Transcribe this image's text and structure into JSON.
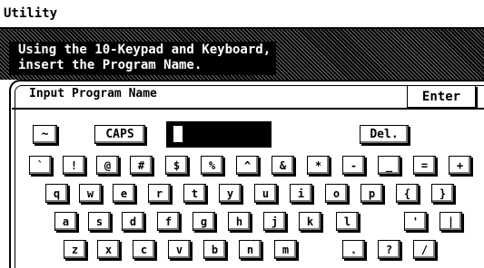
{
  "app": {
    "title": "Utility"
  },
  "instruction": {
    "text": "Using the 10-Keypad and Keyboard,\ninsert the Program Name."
  },
  "panel": {
    "title": "Input Program Name",
    "enter_label": "Enter"
  },
  "input": {
    "value": ""
  },
  "controls": {
    "tilde": "~",
    "caps": "CAPS",
    "delete": "Del."
  },
  "keyboard": {
    "row1": [
      "`",
      "!",
      "@",
      "#",
      "$",
      "%",
      "^",
      "&",
      "*",
      "-",
      "_",
      "=",
      "+"
    ],
    "row2": [
      "q",
      "w",
      "e",
      "r",
      "t",
      "y",
      "u",
      "i",
      "o",
      "p",
      "{",
      "}"
    ],
    "row3": [
      "a",
      "s",
      "d",
      "f",
      "g",
      "h",
      "j",
      "k",
      "l",
      "'",
      "|"
    ],
    "row4": [
      "z",
      "x",
      "c",
      "v",
      "b",
      "n",
      "m",
      ".",
      "?",
      "/"
    ]
  }
}
